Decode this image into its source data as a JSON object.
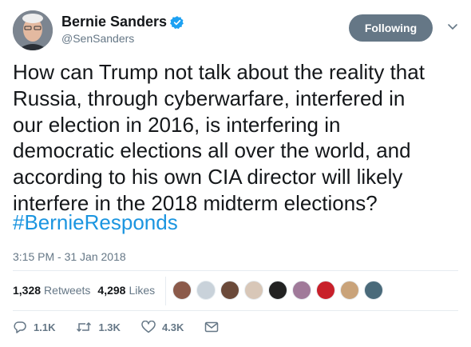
{
  "user": {
    "display_name": "Bernie Sanders",
    "handle": "@SenSanders",
    "avatar_icon": "bernie-avatar-icon",
    "verified_icon": "verified-badge-icon"
  },
  "follow_button": {
    "label": "Following",
    "color": "#657786"
  },
  "caret_icon": "chevron-down-icon",
  "tweet": {
    "text": "How can Trump not talk about the reality that\nRussia, through cyberwarfare, interfered in\nour election in 2016, is interfering in\ndemocratic elections all over the world, and\naccording to his own CIA director will likely\ninterfere in the 2018 midterm elections?",
    "hashtag": "#BernieResponds",
    "timestamp": "3:15 PM - 31 Jan 2018"
  },
  "stats": {
    "retweets_count": "1,328",
    "retweets_label": "Retweets",
    "likes_count": "4,298",
    "likes_label": "Likes"
  },
  "likers": [
    {
      "icon": "liker-avatar-icon",
      "color": "#8b5a4a"
    },
    {
      "icon": "liker-avatar-icon",
      "color": "#c9d2da"
    },
    {
      "icon": "liker-avatar-icon",
      "color": "#6b4a3a"
    },
    {
      "icon": "liker-avatar-icon",
      "color": "#d8c7b8"
    },
    {
      "icon": "liker-avatar-icon",
      "color": "#222222"
    },
    {
      "icon": "liker-avatar-icon",
      "color": "#a07a9a"
    },
    {
      "icon": "liker-avatar-icon",
      "color": "#c8202a"
    },
    {
      "icon": "liker-avatar-icon",
      "color": "#c9a37a"
    },
    {
      "icon": "liker-avatar-icon",
      "color": "#4a6a7a"
    }
  ],
  "actions": {
    "reply_count": "1.1K",
    "retweet_count": "1.3K",
    "like_count": "4.3K",
    "reply_icon": "reply-icon",
    "retweet_icon": "retweet-icon",
    "like_icon": "heart-icon",
    "message_icon": "envelope-icon"
  },
  "colors": {
    "hashtag": "#1b95e0",
    "secondary_text": "#657786",
    "verified": "#1da1f2"
  }
}
